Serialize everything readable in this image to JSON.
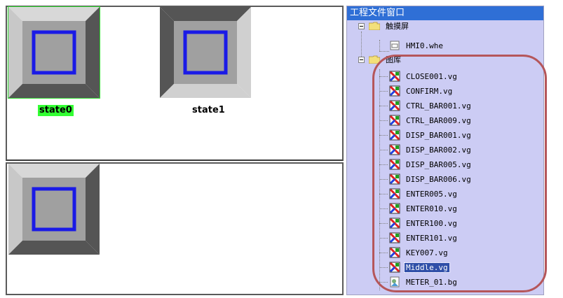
{
  "left": {
    "states": [
      {
        "label": "state0",
        "selected": true
      },
      {
        "label": "state1",
        "selected": false
      }
    ]
  },
  "project_window": {
    "title": "工程文件窗口",
    "tree": {
      "touchscreen": {
        "label": "触摸屏",
        "children": [
          {
            "label": "HMI0.whe"
          }
        ]
      },
      "library": {
        "label": "图库",
        "items": [
          {
            "label": "CLOSE001.vg",
            "icon": "image-file-icon"
          },
          {
            "label": "CONFIRM.vg",
            "icon": "image-file-icon"
          },
          {
            "label": "CTRL_BAR001.vg",
            "icon": "image-file-icon"
          },
          {
            "label": "CTRL_BAR009.vg",
            "icon": "image-file-icon"
          },
          {
            "label": "DISP_BAR001.vg",
            "icon": "image-file-icon"
          },
          {
            "label": "DISP_BAR002.vg",
            "icon": "image-file-icon"
          },
          {
            "label": "DISP_BAR005.vg",
            "icon": "image-file-icon"
          },
          {
            "label": "DISP_BAR006.vg",
            "icon": "image-file-icon"
          },
          {
            "label": "ENTER005.vg",
            "icon": "image-file-icon"
          },
          {
            "label": "ENTER010.vg",
            "icon": "image-file-icon"
          },
          {
            "label": "ENTER100.vg",
            "icon": "image-file-icon"
          },
          {
            "label": "ENTER101.vg",
            "icon": "image-file-icon"
          },
          {
            "label": "KEY007.vg",
            "icon": "image-file-icon"
          },
          {
            "label": "Middle.vg",
            "icon": "image-file-icon",
            "selected": true
          },
          {
            "label": "METER_01.bg",
            "icon": "bitmap-file-icon"
          }
        ]
      }
    }
  },
  "colors": {
    "title_bar": "#2f6fd6",
    "tree_bg": "#ccccf4",
    "selection_green": "#33ff33",
    "highlight_ring": "#b5565a",
    "button_inner_square": "#1a1ae6"
  }
}
